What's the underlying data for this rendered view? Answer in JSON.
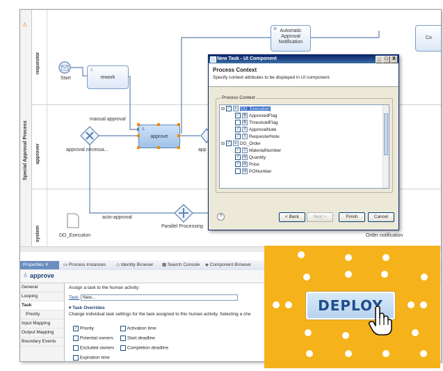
{
  "diagram": {
    "pool_label": "Special Approval Process",
    "lanes": [
      "requestor",
      "approver",
      "system"
    ],
    "nodes": {
      "start": "Start",
      "rework": "rework",
      "approve": "approve",
      "notification": "Automatic\nApproval\nNotification",
      "top_right": "Co",
      "do_execution": "DO_Execution",
      "parallel": "Parallel Processing",
      "order_notification": "Order notification",
      "approver_truncated": "app"
    },
    "edges": {
      "manual_approval": "manual approval",
      "approval_necessary": "approval necessa...",
      "auto_approval": "auto-approval"
    }
  },
  "dialog": {
    "title": "New Task - UI Component",
    "title_buttons": [
      "_",
      "□",
      "X"
    ],
    "heading": "Process Context",
    "subtitle": "Specify context attributes to be displayed in UI component.",
    "group_label": "Process Context",
    "tree": [
      {
        "label": "DO_Execution",
        "level": 0,
        "checked": true,
        "expanded": true,
        "selected": true
      },
      {
        "label": "ApprovedFlag",
        "level": 1,
        "checked": true
      },
      {
        "label": "ThresholdFlag",
        "level": 1,
        "checked": false
      },
      {
        "label": "ApprovalNote",
        "level": 1,
        "checked": true
      },
      {
        "label": "RequesterNote",
        "level": 1,
        "checked": true
      },
      {
        "label": "DO_Order",
        "level": 0,
        "checked": true,
        "expanded": true
      },
      {
        "label": "MaterialNumber",
        "level": 1,
        "checked": true
      },
      {
        "label": "Quantity",
        "level": 1,
        "checked": true
      },
      {
        "label": "Price",
        "level": 1,
        "checked": true
      },
      {
        "label": "PONumber",
        "level": 1,
        "checked": false
      }
    ],
    "buttons": {
      "back": "< Back",
      "next": "Next >",
      "finish": "Finish",
      "cancel": "Cancel"
    }
  },
  "properties": {
    "tabs": [
      "Properties",
      "Process Instances",
      "Identity Browser",
      "Search Console",
      "Component Browser"
    ],
    "title": "approve",
    "side_items": [
      "General",
      "Looping",
      "Task",
      "Priority",
      "Input Mapping",
      "Output Mapping",
      "Boundary Events"
    ],
    "active_side_item": "Task",
    "assign_text": "Assign a task to the human activity:",
    "task_link": "Task:",
    "task_value": "New...",
    "overrides_title": "Task Overrides",
    "overrides_desc": "Change individual task settings for the task assigned to this human activity. Selecting a che",
    "checkboxes": [
      {
        "label": "Priority",
        "checked": true
      },
      {
        "label": "Activation time",
        "checked": false
      },
      {
        "label": "Potential owners",
        "checked": false
      },
      {
        "label": "Start deadline",
        "checked": false
      },
      {
        "label": "Excluded owners",
        "checked": false
      },
      {
        "label": "Completion deadline",
        "checked": false
      },
      {
        "label": "Expiration time",
        "checked": false
      }
    ]
  },
  "deploy": {
    "label": "DEPLOY"
  },
  "colors": {
    "accent": "#f5b21a",
    "deploy_text": "#1f4e8c",
    "selection": "#316ac5"
  }
}
